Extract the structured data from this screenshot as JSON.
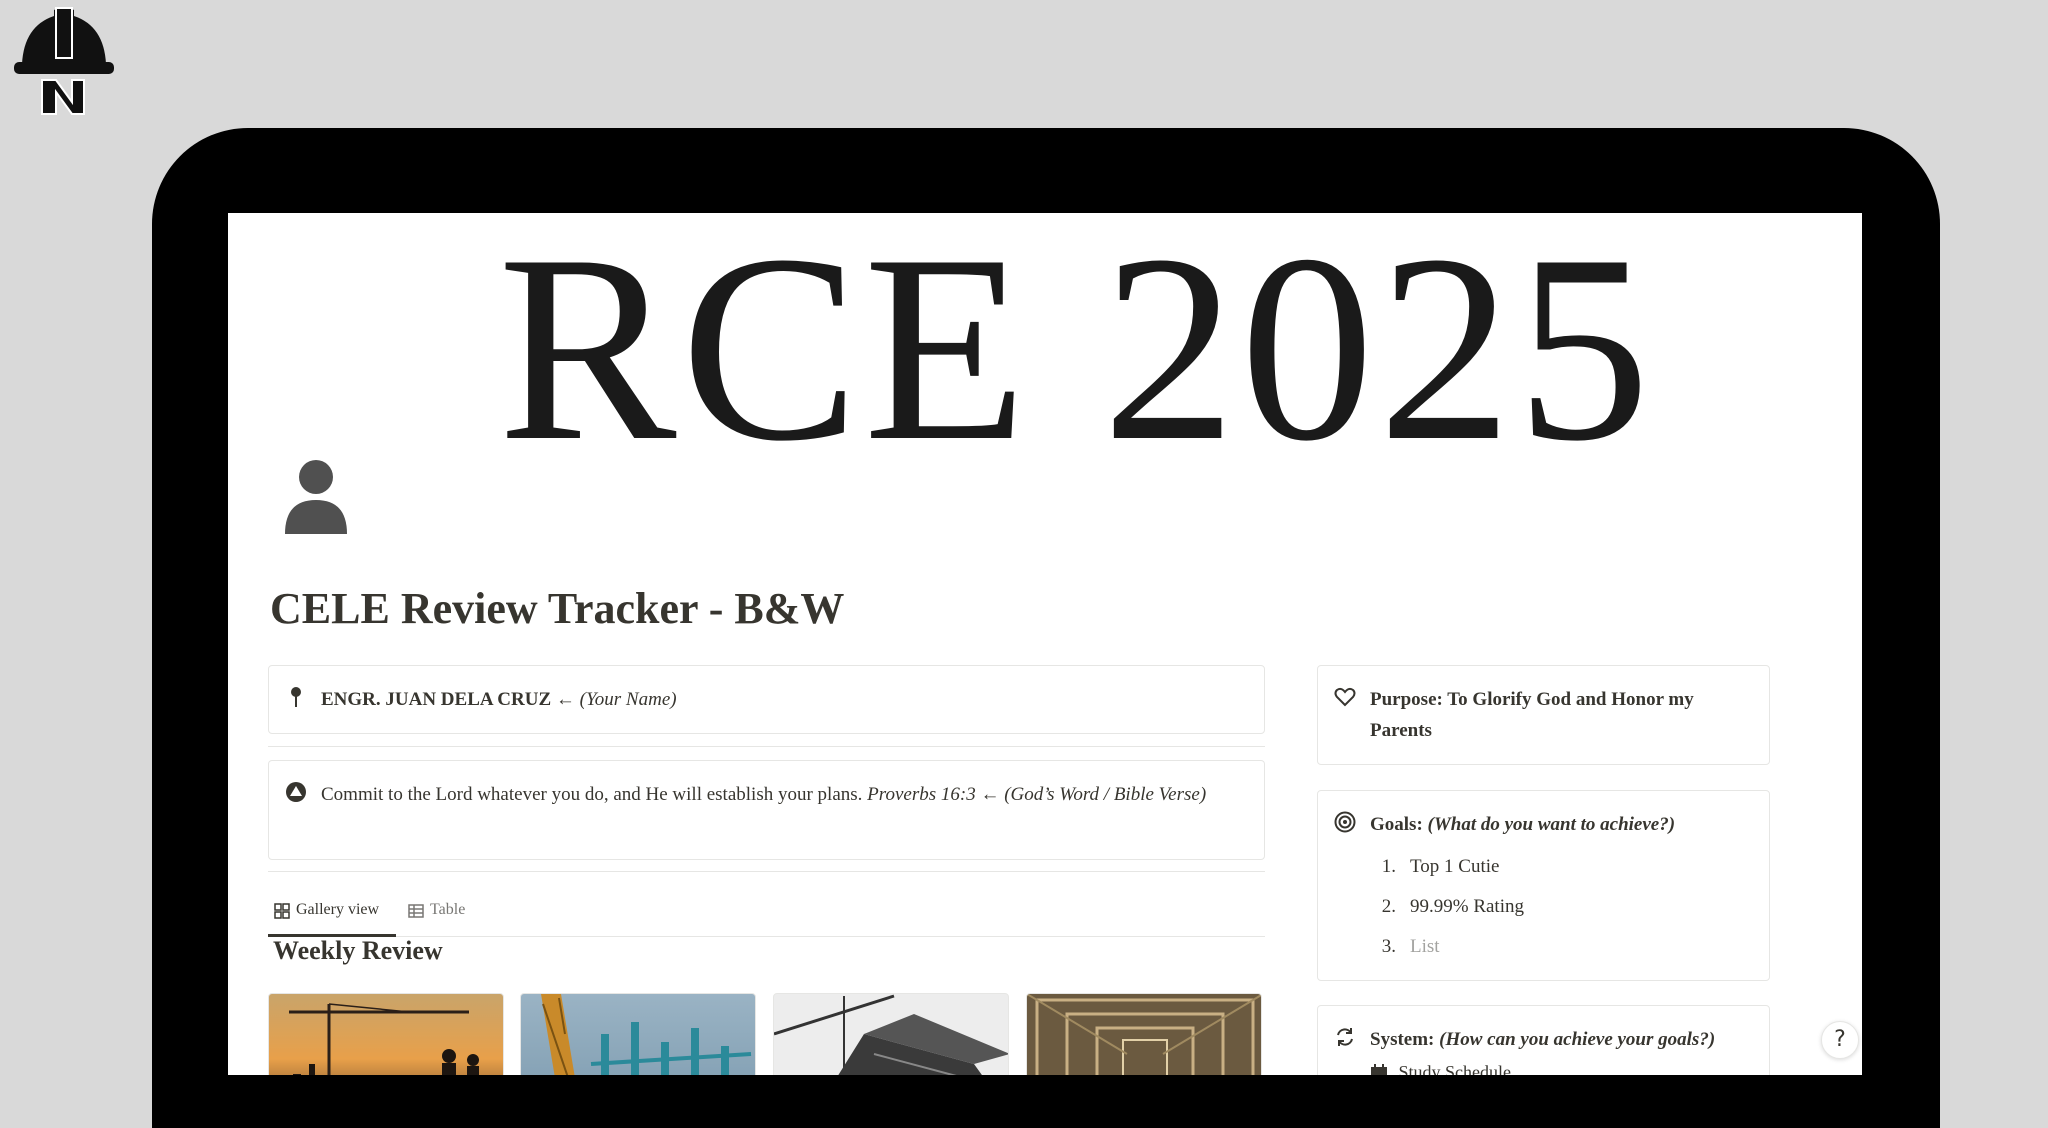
{
  "cover": {
    "title": "RCE 2025"
  },
  "page": {
    "title": "CELE Review Tracker - B&W"
  },
  "name_callout": {
    "icon": "pin-icon",
    "name": "ENGR. JUAN DELA CRUZ",
    "arrow_note": " ← ",
    "hint": "(Your Name)"
  },
  "verse_callout": {
    "icon": "triangle-circle-icon",
    "text": "Commit to the Lord whatever you do, and He will establish your plans. ",
    "reference": "Proverbs 16:3 ← (God’s Word / Bible Verse)"
  },
  "purpose_callout": {
    "icon": "heart-icon",
    "text": "Purpose: To Glorify God and Honor my Parents"
  },
  "goals_callout": {
    "icon": "target-icon",
    "label": "Goals: ",
    "hint": "(What do you want to achieve?)",
    "items": [
      {
        "num": "1.",
        "label": "Top 1 Cutie"
      },
      {
        "num": "2.",
        "label": "99.99% Rating"
      },
      {
        "num": "3.",
        "label": "List"
      }
    ]
  },
  "system_callout": {
    "icon": "refresh-icon",
    "label": "System: ",
    "hint": "(How can you achieve your goals?)",
    "sub_item": "Study Schedule"
  },
  "view_tabs": [
    {
      "label": "Gallery view",
      "icon": "gallery-icon",
      "active": true
    },
    {
      "label": "Table",
      "icon": "table-icon",
      "active": false
    }
  ],
  "gallery": {
    "title": "Weekly Review",
    "cards": [
      {
        "name": "sunset-construction-card"
      },
      {
        "name": "crane-rebar-card"
      },
      {
        "name": "building-frame-card"
      },
      {
        "name": "scaffold-corridor-card"
      }
    ]
  },
  "help_button": {
    "label": "?"
  }
}
